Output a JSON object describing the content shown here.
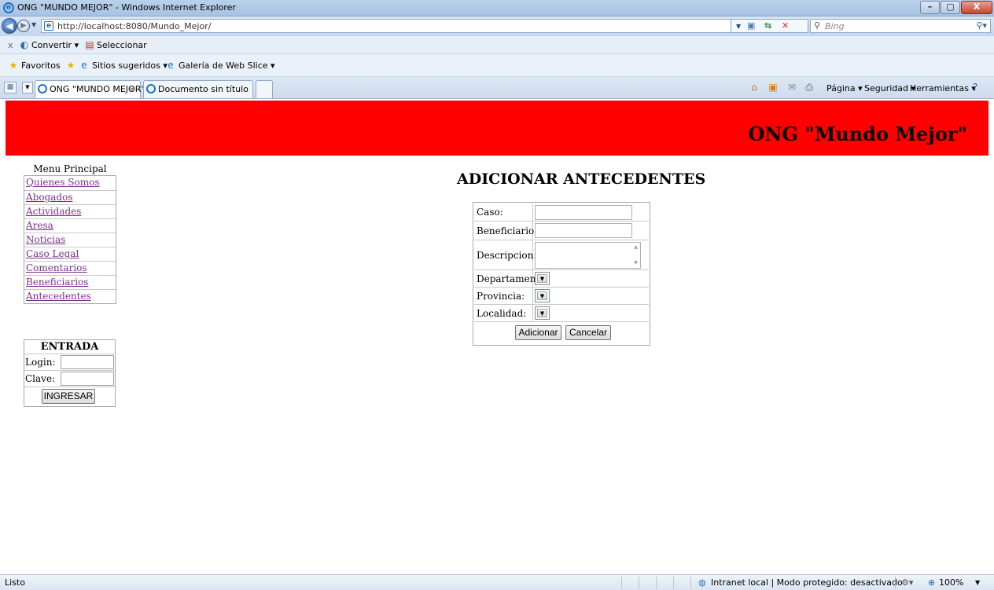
{
  "window": {
    "title": "ONG \"MUNDO MEJOR\" - Windows Internet Explorer",
    "min_label": "–",
    "max_label": "▢",
    "close_label": "X"
  },
  "address_bar": {
    "url": "http://localhost:8080/Mundo_Mejor/",
    "search_placeholder": "Bing"
  },
  "command_bar": {
    "close_label": "x",
    "convert_label": "Convertir ▾",
    "select_label": "Seleccionar"
  },
  "favorites_bar": {
    "favorites_label": "Favoritos",
    "suggested_label": "Sitios sugeridos ▾",
    "webslice_label": "Galería de Web Slice ▾"
  },
  "tabs": [
    {
      "label": "ONG \"MUNDO MEJOR\"",
      "active": true
    },
    {
      "label": "Documento sin título",
      "active": false
    }
  ],
  "toolbar_right": {
    "page_label": "Página ▾",
    "security_label": "Seguridad ▾",
    "tools_label": "Herramientas ▾"
  },
  "banner": {
    "title": "ONG \"Mundo Mejor\"",
    "color": "#ff0000"
  },
  "menu": {
    "header": "Menu Principal",
    "items": [
      "Quienes Somos",
      "Abogados",
      "Actividades",
      "Aresa",
      "Noticias",
      "Caso Legal",
      "Comentarios",
      "Beneficiarios",
      "Antecedentes"
    ],
    "link_color": "#7a2c8f"
  },
  "login": {
    "title": "ENTRADA",
    "login_label": "Login:",
    "password_label": "Clave:",
    "submit_label": "INGRESAR"
  },
  "form": {
    "title": "ADICIONAR ANTECEDENTES",
    "case_label": "Caso:",
    "beneficiary_label": "Beneficiario:",
    "description_label": "Descripcion:",
    "department_label": "Departamento:",
    "province_label": "Provincia:",
    "locality_label": "Localidad:",
    "add_label": "Adicionar",
    "cancel_label": "Cancelar"
  },
  "status_bar": {
    "status": "Listo",
    "zone": "Intranet local | Modo protegido: desactivado",
    "zoom": "100%"
  }
}
